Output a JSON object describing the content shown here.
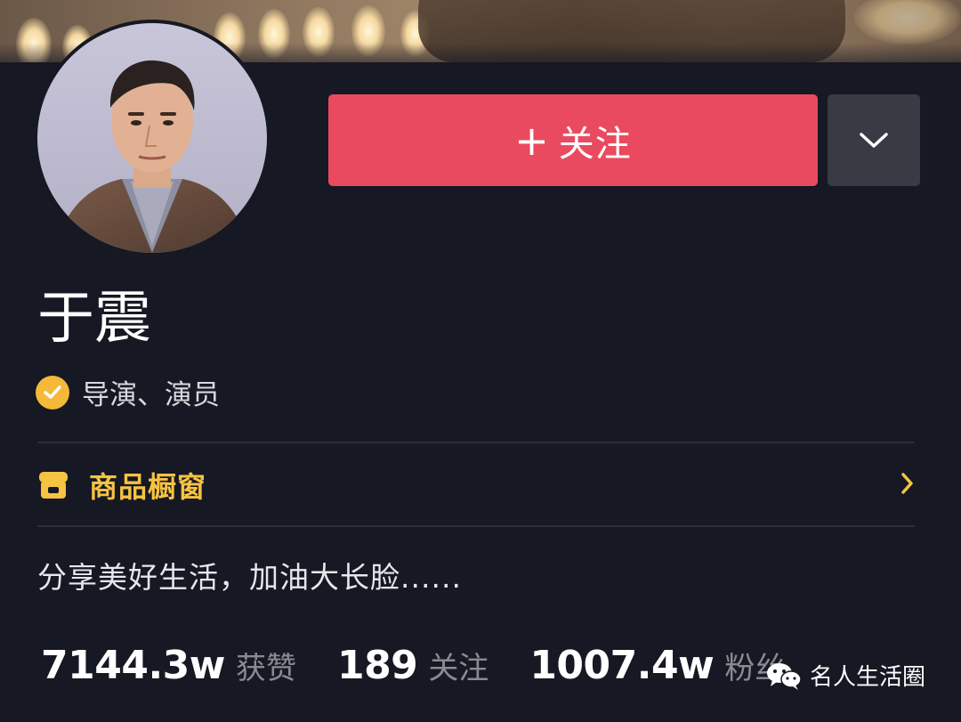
{
  "profile": {
    "name": "于震",
    "verified_title": "导演、演员",
    "bio": "分享美好生活，加油大长脸......"
  },
  "actions": {
    "follow_label": "关注",
    "follow_prefix": "+",
    "more_icon": "chevron-down-icon"
  },
  "shop": {
    "label": "商品橱窗",
    "icon": "storefront-icon"
  },
  "stats": [
    {
      "value": "7144.3w",
      "label": "获赞"
    },
    {
      "value": "189",
      "label": "关注"
    },
    {
      "value": "1007.4w",
      "label": "粉丝"
    }
  ],
  "watermark": {
    "text": "名人生活圈",
    "icon": "wechat-icon"
  },
  "colors": {
    "background": "#161823",
    "follow_button": "#ea4a5f",
    "more_button": "#393b44",
    "verify_badge": "#f5b93a",
    "shop_text": "#f6c342",
    "stat_label": "#8a8b91"
  }
}
